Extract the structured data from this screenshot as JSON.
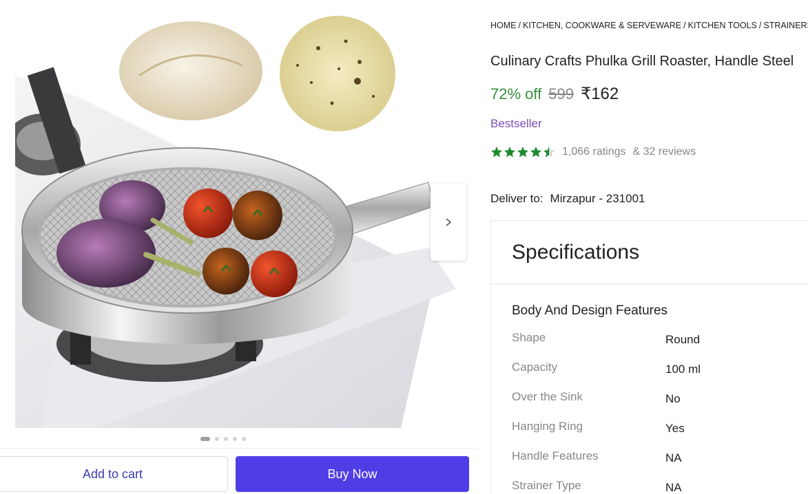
{
  "gallery": {
    "dot_count": 5,
    "active_dot": 0
  },
  "actions": {
    "add_to_cart": "Add to cart",
    "buy_now": "Buy Now"
  },
  "breadcrumb": [
    "HOME",
    "KITCHEN, COOKWARE & SERVEWARE",
    "KITCHEN TOOLS",
    "STRAINERS"
  ],
  "product": {
    "title": "Culinary Crafts Phulka Grill Roaster, Handle Steel",
    "discount": "72% off",
    "mrp": "599",
    "price": "₹162",
    "badge": "Bestseller",
    "rating_value": 4.5,
    "ratings": "1,066 ratings",
    "reviews": "& 32 reviews"
  },
  "delivery": {
    "label": "Deliver to:",
    "location": "Mirzapur - 231001"
  },
  "specifications": {
    "title": "Specifications",
    "group_title": "Body And Design Features",
    "rows": [
      {
        "key": "Shape",
        "value": "Round"
      },
      {
        "key": "Capacity",
        "value": "100 ml"
      },
      {
        "key": "Over the Sink",
        "value": "No"
      },
      {
        "key": "Hanging Ring",
        "value": "Yes"
      },
      {
        "key": "Handle Features",
        "value": "NA"
      },
      {
        "key": "Strainer Type",
        "value": "NA"
      }
    ]
  },
  "colors": {
    "discount": "#388e3c",
    "badge": "#7b4fb6",
    "star": "#1e8a2f",
    "buy_button": "#4f3ee6",
    "cart_text": "#3b3fb1"
  }
}
